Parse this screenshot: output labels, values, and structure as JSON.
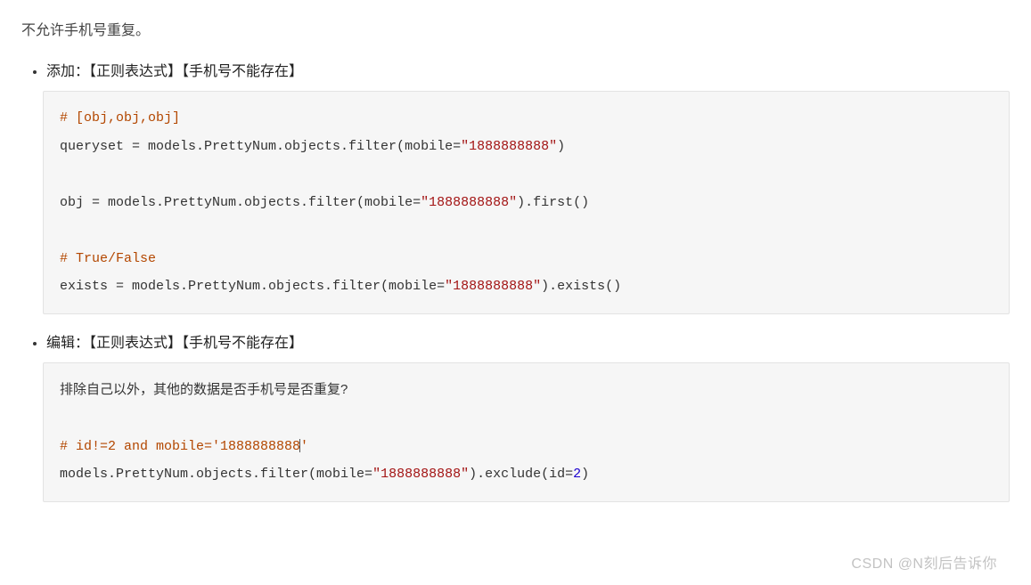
{
  "intro": "不允许手机号重复。",
  "items": [
    {
      "label": "添加：【正则表达式】【手机号不能存在】",
      "code": {
        "c1": "# [obj,obj,obj]",
        "l2a": "queryset = models.PrettyNum.objects.filter(mobile=",
        "l2s": "\"1888888888\"",
        "l2b": ")",
        "l3a": "obj = models.PrettyNum.objects.filter(mobile=",
        "l3s": "\"1888888888\"",
        "l3b": ").first()",
        "c4": "# True/False",
        "l5a": "exists = models.PrettyNum.objects.filter(mobile=",
        "l5s": "\"1888888888\"",
        "l5b": ").exists()"
      }
    },
    {
      "label": "编辑：【正则表达式】【手机号不能存在】",
      "code": {
        "note": "排除自己以外，其他的数据是否手机号是否重复?",
        "c1a": "# id!=2 and mobile='1888888888",
        "c1b": "'",
        "l2a": "models.PrettyNum.objects.filter(mobile=",
        "l2s": "\"1888888888\"",
        "l2b": ").exclude(id=",
        "l2n": "2",
        "l2c": ")"
      }
    }
  ],
  "watermark": "CSDN @N刻后告诉你"
}
